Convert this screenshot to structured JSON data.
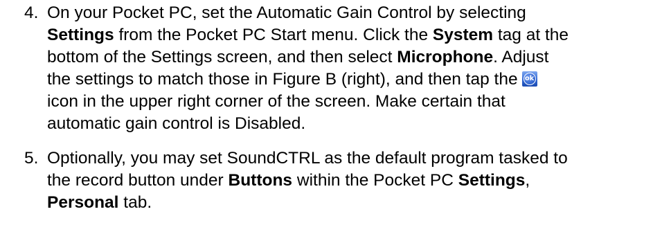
{
  "document": {
    "items": [
      {
        "number": "4.",
        "lines": [
          [
            {
              "t": "On your Pocket PC, set the Automatic Gain Control by selecting",
              "b": false
            }
          ],
          [
            {
              "t": "Settings",
              "b": true
            },
            {
              "t": " from the Pocket PC Start menu.  Click the ",
              "b": false
            },
            {
              "t": "System",
              "b": true
            },
            {
              "t": " tag at the",
              "b": false
            }
          ],
          [
            {
              "t": "bottom of the Settings screen, and then select ",
              "b": false
            },
            {
              "t": "Microphone",
              "b": true
            },
            {
              "t": ".  Adjust",
              "b": false
            }
          ],
          [
            {
              "t": "the settings to match those in Figure B (right), and then tap the",
              "b": false
            },
            {
              "icon": "ok-icon"
            }
          ],
          [
            {
              "t": "icon in the upper right corner of the screen.  Make certain that",
              "b": false
            }
          ],
          [
            {
              "t": "automatic gain control is Disabled.",
              "b": false
            }
          ]
        ]
      },
      {
        "number": "5.",
        "lines": [
          [
            {
              "t": "Optionally, you may set SoundCTRL as the default program tasked to",
              "b": false
            }
          ],
          [
            {
              "t": "the record button under ",
              "b": false
            },
            {
              "t": "Buttons",
              "b": true
            },
            {
              "t": " within the Pocket PC ",
              "b": false
            },
            {
              "t": "Settings",
              "b": true
            },
            {
              "t": ",",
              "b": false
            }
          ],
          [
            {
              "t": "Personal",
              "b": true
            },
            {
              "t": " tab.",
              "b": false
            }
          ]
        ]
      }
    ],
    "ok_icon_label": "ok"
  }
}
